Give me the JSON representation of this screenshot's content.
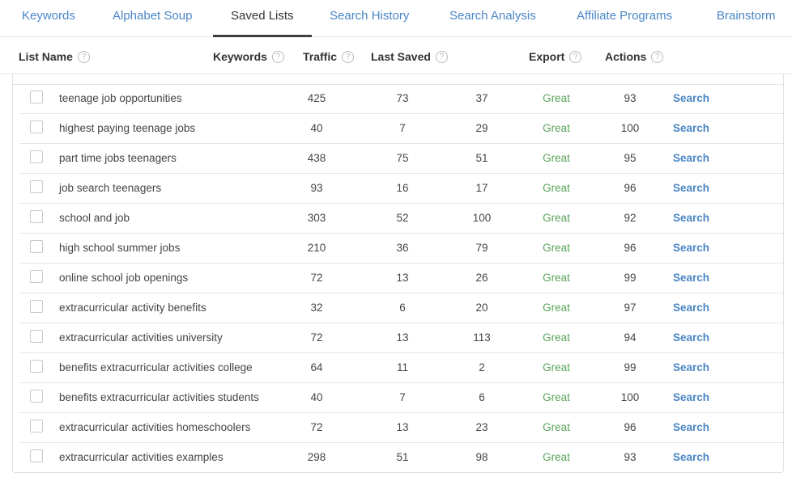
{
  "tabs": [
    {
      "label": "Keywords",
      "active": false
    },
    {
      "label": "Alphabet Soup",
      "active": false
    },
    {
      "label": "Saved Lists",
      "active": true
    },
    {
      "label": "Search History",
      "active": false
    },
    {
      "label": "Search Analysis",
      "active": false
    },
    {
      "label": "Affiliate Programs",
      "active": false
    },
    {
      "label": "Brainstorm",
      "active": false
    }
  ],
  "columns": {
    "list_name": "List Name",
    "keywords": "Keywords",
    "traffic": "Traffic",
    "last_saved": "Last Saved",
    "export": "Export",
    "actions": "Actions"
  },
  "help_glyph": "?",
  "colors": {
    "link": "#4a86c5",
    "great": "#5aa35a",
    "active_tab_underline": "#3b3f44"
  },
  "rows": [
    {
      "keyword": "teenage job opportunities",
      "v1": "425",
      "v2": "73",
      "v3": "37",
      "quality": "Great",
      "v5": "93",
      "action": "Search"
    },
    {
      "keyword": "highest paying teenage jobs",
      "v1": "40",
      "v2": "7",
      "v3": "29",
      "quality": "Great",
      "v5": "100",
      "action": "Search"
    },
    {
      "keyword": "part time jobs teenagers",
      "v1": "438",
      "v2": "75",
      "v3": "51",
      "quality": "Great",
      "v5": "95",
      "action": "Search"
    },
    {
      "keyword": "job search teenagers",
      "v1": "93",
      "v2": "16",
      "v3": "17",
      "quality": "Great",
      "v5": "96",
      "action": "Search"
    },
    {
      "keyword": "school and job",
      "v1": "303",
      "v2": "52",
      "v3": "100",
      "quality": "Great",
      "v5": "92",
      "action": "Search"
    },
    {
      "keyword": "high school summer jobs",
      "v1": "210",
      "v2": "36",
      "v3": "79",
      "quality": "Great",
      "v5": "96",
      "action": "Search"
    },
    {
      "keyword": "online school job openings",
      "v1": "72",
      "v2": "13",
      "v3": "26",
      "quality": "Great",
      "v5": "99",
      "action": "Search"
    },
    {
      "keyword": "extracurricular activity benefits",
      "v1": "32",
      "v2": "6",
      "v3": "20",
      "quality": "Great",
      "v5": "97",
      "action": "Search"
    },
    {
      "keyword": "extracurricular activities university",
      "v1": "72",
      "v2": "13",
      "v3": "113",
      "quality": "Great",
      "v5": "94",
      "action": "Search"
    },
    {
      "keyword": "benefits extracurricular activities college",
      "v1": "64",
      "v2": "11",
      "v3": "2",
      "quality": "Great",
      "v5": "99",
      "action": "Search"
    },
    {
      "keyword": "benefits extracurricular activities students",
      "v1": "40",
      "v2": "7",
      "v3": "6",
      "quality": "Great",
      "v5": "100",
      "action": "Search"
    },
    {
      "keyword": "extracurricular activities homeschoolers",
      "v1": "72",
      "v2": "13",
      "v3": "23",
      "quality": "Great",
      "v5": "96",
      "action": "Search"
    },
    {
      "keyword": "extracurricular activities examples",
      "v1": "298",
      "v2": "51",
      "v3": "98",
      "quality": "Great",
      "v5": "93",
      "action": "Search"
    }
  ]
}
